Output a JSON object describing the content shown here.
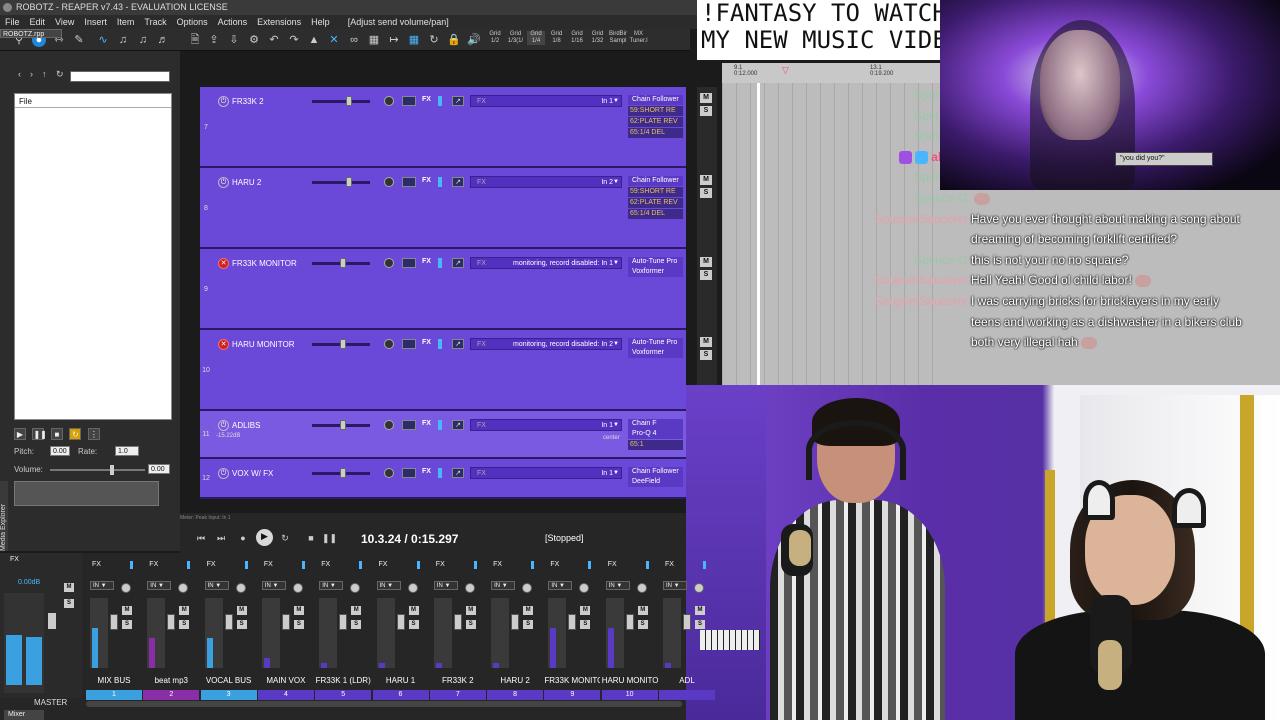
{
  "window": {
    "title": "ROBOTZ - REAPER v7.43 - EVALUATION LICENSE",
    "project_tab": "ROBOTZ.rpp"
  },
  "menu": {
    "items": [
      "File",
      "Edit",
      "View",
      "Insert",
      "Item",
      "Track",
      "Options",
      "Actions",
      "Extensions",
      "Help"
    ],
    "last_action": "[Adjust send volume/pan]"
  },
  "toolbar": {
    "grid_buttons": [
      "Grid\n1/2",
      "Grid\n1/3(1/",
      "Grid\n1/4",
      "Grid\n1/8",
      "Grid\n1/16",
      "Grid\n1/32",
      "BirdBir\nSampl",
      "MX\nTuner.l"
    ]
  },
  "media_explorer": {
    "file_header": "File",
    "pitch_label": "Pitch:",
    "pitch_value": "0.00",
    "rate_label": "Rate:",
    "rate_value": "1.0",
    "volume_label": "Volume:",
    "volume_value": "0.00",
    "side_label": "Media Explorer"
  },
  "tracks": [
    {
      "num": "7",
      "name": "FR33K 2",
      "input_label": "FX",
      "input": "In 1",
      "chain": [
        "Chain Follower"
      ],
      "chain_fx": [
        "59:SHORT RE",
        "62:PLATE REV",
        "65:1/4 DEL"
      ],
      "record": false
    },
    {
      "num": "8",
      "name": "HARU 2",
      "input_label": "FX",
      "input": "In 2",
      "chain": [
        "Chain Follower"
      ],
      "chain_fx": [
        "59:SHORT RE",
        "62:PLATE REV",
        "65:1/4 DEL"
      ],
      "record": false
    },
    {
      "num": "9",
      "name": "FR33K MONITOR",
      "input_label": "FX",
      "input": "monitoring, record disabled: In 1",
      "chain": [
        "Auto-Tune Pro",
        "Voxformer"
      ],
      "chain_fx": [],
      "record": true
    },
    {
      "num": "10",
      "name": "HARU MONITOR",
      "input_label": "FX",
      "input": "monitoring, record disabled: In 2",
      "chain": [
        "Auto-Tune Pro",
        "Voxformer"
      ],
      "chain_fx": [],
      "record": true
    },
    {
      "num": "11",
      "name": "ADLIBS",
      "input_label": "FX",
      "input": "In 1",
      "chain": [
        "Chain F",
        "Pro-Q 4"
      ],
      "chain_fx": [
        "65:1"
      ],
      "record": false,
      "sub": "-15.22dB",
      "pan": "center"
    },
    {
      "num": "12",
      "name": "VOX W/ FX",
      "input_label": "FX",
      "input": "In 1",
      "chain": [
        "Chain Follower",
        "DeeField"
      ],
      "chain_fx": [],
      "record": false
    }
  ],
  "transport": {
    "meter_label": "Meter: Peak Input: In 1",
    "time": "10.3.24 / 0:15.297",
    "status": "[Stopped]"
  },
  "ruler": {
    "marks": [
      "9.1\n0:12.000",
      "13.1\n0:19.200"
    ]
  },
  "overlay": {
    "promo_line1": "!FANTASY TO WATCH",
    "promo_line2": "MY NEW MUSIC VIDEO",
    "promo_caption": "\"you did you?\""
  },
  "chat": [
    {
      "user": "Spence-G",
      "msg": "",
      "color": "green"
    },
    {
      "user": "Spence-G",
      "msg": "",
      "color": "green"
    },
    {
      "user": "Spence-G",
      "msg": "",
      "color": "green"
    },
    {
      "user": "allis_s",
      "msg": "",
      "color": "pink",
      "badges": true
    },
    {
      "user": "Spence-G",
      "msg": "",
      "color": "green"
    },
    {
      "user": "Spence-G",
      "msg": "",
      "color": "green",
      "emote": true
    },
    {
      "user": "SoupserSaucerer",
      "msg": "Have you ever thought about making a song about",
      "color": "red"
    },
    {
      "user": "",
      "msg": "dreaming of becoming forklift certified?",
      "color": "red"
    },
    {
      "user": "Spence-G",
      "msg": "this is not your no no square?",
      "color": "green"
    },
    {
      "user": "SoupserSaucerer",
      "msg": "Hell Yeah! Good ol child labor!",
      "color": "red",
      "emote": true
    },
    {
      "user": "SoupserSaucerer",
      "msg": "I was carrying bricks for bricklayers in my early",
      "color": "red"
    },
    {
      "user": "",
      "msg": "teens and working as a dishwasher in a bikers club",
      "color": "red"
    },
    {
      "user": "",
      "msg": "both very illegal hah",
      "color": "red",
      "emote": true
    }
  ],
  "mixer": {
    "master_label": "MASTER",
    "master_vol": "0.00dB",
    "tab": "Mixer",
    "channels": [
      {
        "name": "MIX BUS",
        "num": "1",
        "color": "#3aa0e0"
      },
      {
        "name": "beat mp3",
        "num": "2",
        "color": "#8a2ea8"
      },
      {
        "name": "VOCAL BUS",
        "num": "3",
        "color": "#3aa0e0"
      },
      {
        "name": "MAIN VOX",
        "num": "4",
        "color": "#5a3ac4"
      },
      {
        "name": "FR33K 1 (LDR)",
        "num": "5",
        "color": "#5a3ac4"
      },
      {
        "name": "HARU 1",
        "num": "6",
        "color": "#5a3ac4"
      },
      {
        "name": "FR33K 2",
        "num": "7",
        "color": "#5a3ac4"
      },
      {
        "name": "HARU 2",
        "num": "8",
        "color": "#5a3ac4"
      },
      {
        "name": "FR33K MONITO",
        "num": "9",
        "color": "#5a3ac4"
      },
      {
        "name": "HARU MONITO",
        "num": "10",
        "color": "#5a3ac4"
      },
      {
        "name": "ADL",
        "num": "",
        "color": "#5a3ac4"
      }
    ]
  }
}
